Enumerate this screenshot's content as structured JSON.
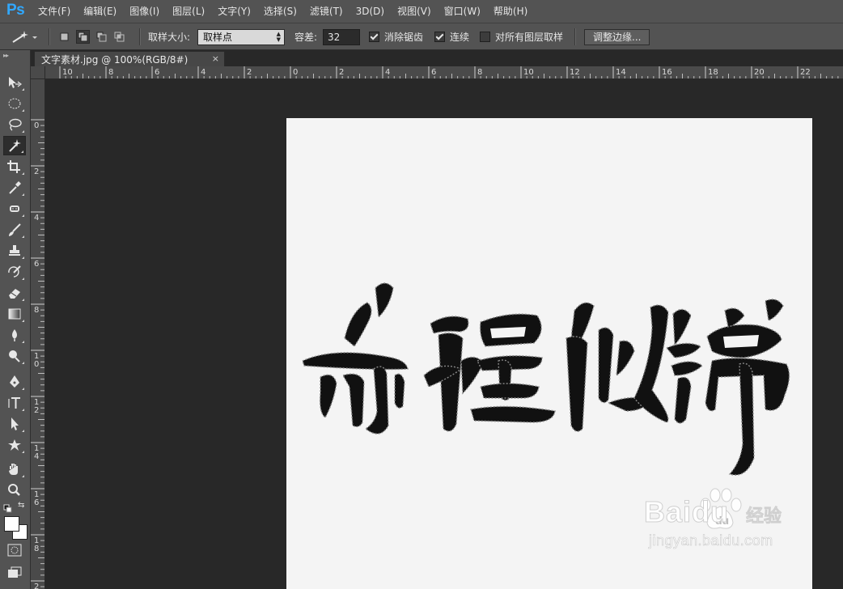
{
  "app": {
    "logo": "Ps"
  },
  "menu": [
    "文件(F)",
    "编辑(E)",
    "图像(I)",
    "图层(L)",
    "文字(Y)",
    "选择(S)",
    "滤镜(T)",
    "3D(D)",
    "视图(V)",
    "窗口(W)",
    "帮助(H)"
  ],
  "options": {
    "sample_size_label": "取样大小:",
    "sample_size_value": "取样点",
    "tolerance_label": "容差:",
    "tolerance_value": "32",
    "anti_alias_label": "消除锯齿",
    "anti_alias_checked": true,
    "contiguous_label": "连续",
    "contiguous_checked": true,
    "sample_all_layers_label": "对所有图层取样",
    "sample_all_layers_checked": false,
    "refine_edge_label": "调整边缘..."
  },
  "document": {
    "tab_title": "文字素材.jpg @ 100%(RGB/8#)",
    "close_glyph": "×",
    "artwork_text": "前程似锦"
  },
  "rulers": {
    "horizontal_labels": [
      "10",
      "8",
      "6",
      "4",
      "2",
      "0",
      "2",
      "4",
      "6",
      "8",
      "10",
      "12",
      "14",
      "16",
      "18",
      "20",
      "22"
    ],
    "vertical_labels": [
      "0",
      "2",
      "4",
      "6",
      "8",
      "10",
      "12",
      "14",
      "16",
      "18",
      "2"
    ]
  },
  "tools": [
    "move-icon",
    "marquee-icon",
    "lasso-icon",
    "magic-wand-icon",
    "crop-icon",
    "eyedropper-icon",
    "healing-brush-icon",
    "brush-icon",
    "clone-stamp-icon",
    "history-brush-icon",
    "eraser-icon",
    "gradient-icon",
    "blur-icon",
    "dodge-icon",
    "pen-icon",
    "type-icon",
    "path-selection-icon",
    "shape-icon",
    "hand-icon",
    "zoom-icon"
  ],
  "watermark": {
    "brand": "Baidu",
    "brand_cn": "经验",
    "url": "jingyan.baidu.com"
  },
  "colors": {
    "accent": "#31a8ff",
    "chrome": "#535353",
    "workspace": "#282828",
    "canvas": "#f4f4f4"
  }
}
